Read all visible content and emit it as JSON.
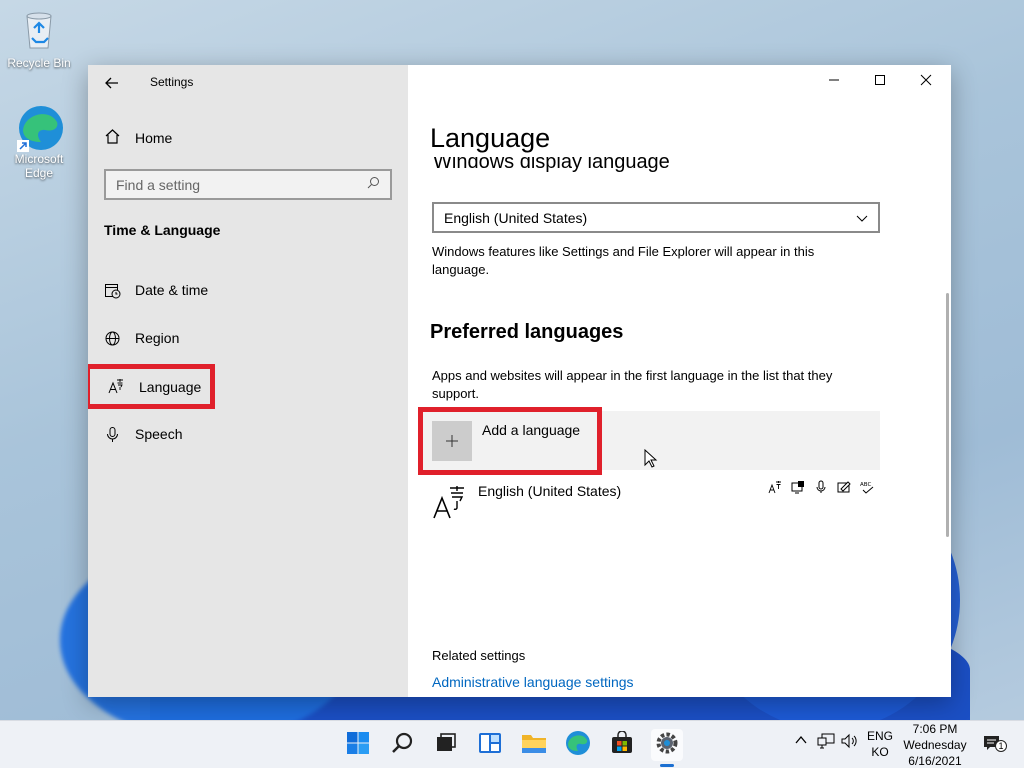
{
  "desktop": {
    "icons": [
      {
        "label": "Recycle Bin"
      },
      {
        "label": "Microsoft Edge"
      }
    ]
  },
  "window": {
    "title": "Settings",
    "sidebar": {
      "home_label": "Home",
      "search_placeholder": "Find a setting",
      "section_heading": "Time & Language",
      "items": [
        {
          "label": "Date & time",
          "icon": "calendar-clock-icon"
        },
        {
          "label": "Region",
          "icon": "globe-icon"
        },
        {
          "label": "Language",
          "icon": "language-icon",
          "active": true
        },
        {
          "label": "Speech",
          "icon": "microphone-icon"
        }
      ]
    },
    "main": {
      "page_title": "Language",
      "cut_heading": "Windows display language",
      "display_language_value": "English (United States)",
      "display_language_desc": "Windows features like Settings and File Explorer will appear in this language.",
      "preferred_heading": "Preferred languages",
      "preferred_desc": "Apps and websites will appear in the first language in the list that they support.",
      "add_language_label": "Add a language",
      "installed_languages": [
        {
          "name": "English (United States)",
          "features": [
            "display-language-icon",
            "text-to-speech-icon",
            "speech-icon",
            "handwriting-icon",
            "spell-check-icon"
          ]
        }
      ],
      "related_heading": "Related settings",
      "admin_link": "Administrative language settings"
    },
    "highlight_color": "#e0202b",
    "link_color": "#0067c0"
  },
  "taskbar": {
    "apps": [
      "start-icon",
      "search-icon",
      "task-view-icon",
      "widgets-icon",
      "file-explorer-icon",
      "edge-icon",
      "store-icon",
      "settings-icon"
    ],
    "active_app": "settings-icon",
    "lang_top": "ENG",
    "lang_bottom": "KO",
    "time": "7:06 PM",
    "day": "Wednesday",
    "date": "6/16/2021",
    "notification_count": "1"
  }
}
